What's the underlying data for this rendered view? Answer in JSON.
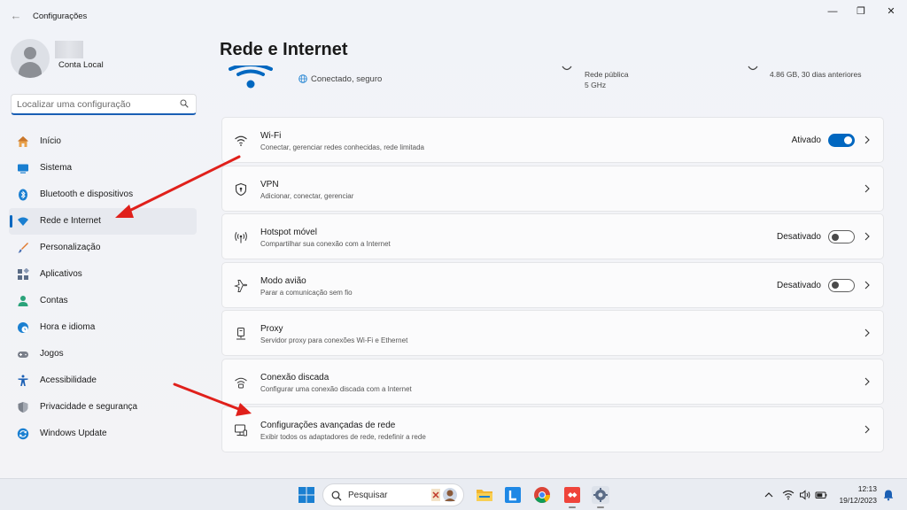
{
  "window": {
    "app_title": "Configurações",
    "back_glyph": "←",
    "min_glyph": "—",
    "max_glyph": "❐",
    "close_glyph": "✕"
  },
  "account": {
    "type": "Conta Local"
  },
  "search": {
    "placeholder": "Localizar uma configuração"
  },
  "sidebar": {
    "items": [
      {
        "label": "Início",
        "icon": "home-icon",
        "color": "#c9762b"
      },
      {
        "label": "Sistema",
        "icon": "system-icon",
        "color": "#1a7fd1"
      },
      {
        "label": "Bluetooth e dispositivos",
        "icon": "bluetooth-icon",
        "color": "#1a7fd1"
      },
      {
        "label": "Rede e Internet",
        "icon": "network-icon",
        "color": "#1a7fd1",
        "active": true
      },
      {
        "label": "Personalização",
        "icon": "brush-icon",
        "color": "#e07a2e"
      },
      {
        "label": "Aplicativos",
        "icon": "apps-icon",
        "color": "#5a6b86"
      },
      {
        "label": "Contas",
        "icon": "accounts-icon",
        "color": "#2aa37a"
      },
      {
        "label": "Hora e idioma",
        "icon": "clock-globe-icon",
        "color": "#1a7fd1"
      },
      {
        "label": "Jogos",
        "icon": "gamepad-icon",
        "color": "#7a7f8a"
      },
      {
        "label": "Acessibilidade",
        "icon": "accessibility-icon",
        "color": "#1a5fb4"
      },
      {
        "label": "Privacidade e segurança",
        "icon": "shield-icon",
        "color": "#6b7280"
      },
      {
        "label": "Windows Update",
        "icon": "update-icon",
        "color": "#1a7fd1"
      }
    ]
  },
  "main": {
    "title": "Rede e Internet",
    "status": {
      "connection": "Conectado, seguro",
      "network_type": "Rede pública",
      "band": "5 GHz",
      "data_usage": "4.86 GB, 30 dias anteriores"
    },
    "cards": [
      {
        "title": "Wi-Fi",
        "subtitle": "Conectar, gerenciar redes conhecidas, rede limitada",
        "icon": "wifi-icon",
        "toggle_label": "Ativado",
        "toggle": "on"
      },
      {
        "title": "VPN",
        "subtitle": "Adicionar, conectar, gerenciar",
        "icon": "vpn-shield-icon"
      },
      {
        "title": "Hotspot móvel",
        "subtitle": "Compartilhar sua conexão com a Internet",
        "icon": "hotspot-icon",
        "toggle_label": "Desativado",
        "toggle": "off"
      },
      {
        "title": "Modo avião",
        "subtitle": "Parar a comunicação sem fio",
        "icon": "airplane-icon",
        "toggle_label": "Desativado",
        "toggle": "off"
      },
      {
        "title": "Proxy",
        "subtitle": "Servidor proxy para conexões Wi-Fi e Ethernet",
        "icon": "proxy-icon"
      },
      {
        "title": "Conexão discada",
        "subtitle": "Configurar uma conexão discada com a Internet",
        "icon": "dialup-icon"
      },
      {
        "title": "Configurações avançadas de rede",
        "subtitle": "Exibir todos os adaptadores de rede, redefinir a rede",
        "icon": "advanced-network-icon"
      }
    ]
  },
  "annotations": {
    "arrow_color": "#e0201b"
  },
  "taskbar": {
    "search_label": "Pesquisar",
    "time": "12:13",
    "date": "19/12/2023",
    "apps": [
      "file-explorer-icon",
      "l-app-icon",
      "chrome-icon",
      "anydesk-icon",
      "settings-gear-icon"
    ]
  }
}
